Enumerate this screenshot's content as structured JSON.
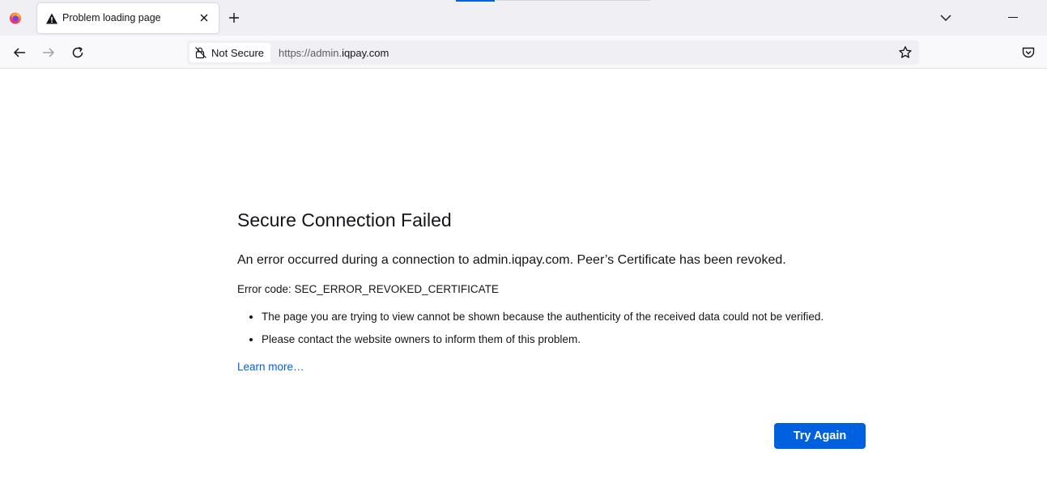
{
  "browser": {
    "tab": {
      "title": "Problem loading page",
      "icon": "warning-icon"
    },
    "urlbar": {
      "identity_label": "Not Secure",
      "url_scheme": "https://",
      "url_host": "admin.iqpay.com",
      "url_prefix": "admin."
    }
  },
  "error_page": {
    "title": "Secure Connection Failed",
    "short_desc": "An error occurred during a connection to admin.iqpay.com. Peer’s Certificate has been revoked.",
    "error_code": "Error code: SEC_ERROR_REVOKED_CERTIFICATE",
    "bullets": [
      "The page you are trying to view cannot be shown because the authenticity of the received data could not be verified.",
      "Please contact the website owners to inform them of this problem."
    ],
    "learn_more": "Learn more…",
    "try_again": "Try Again"
  },
  "colors": {
    "accent": "#0061e0",
    "tabstrip_bg": "#f0f0f4",
    "navbar_bg": "#f9f9fb"
  }
}
